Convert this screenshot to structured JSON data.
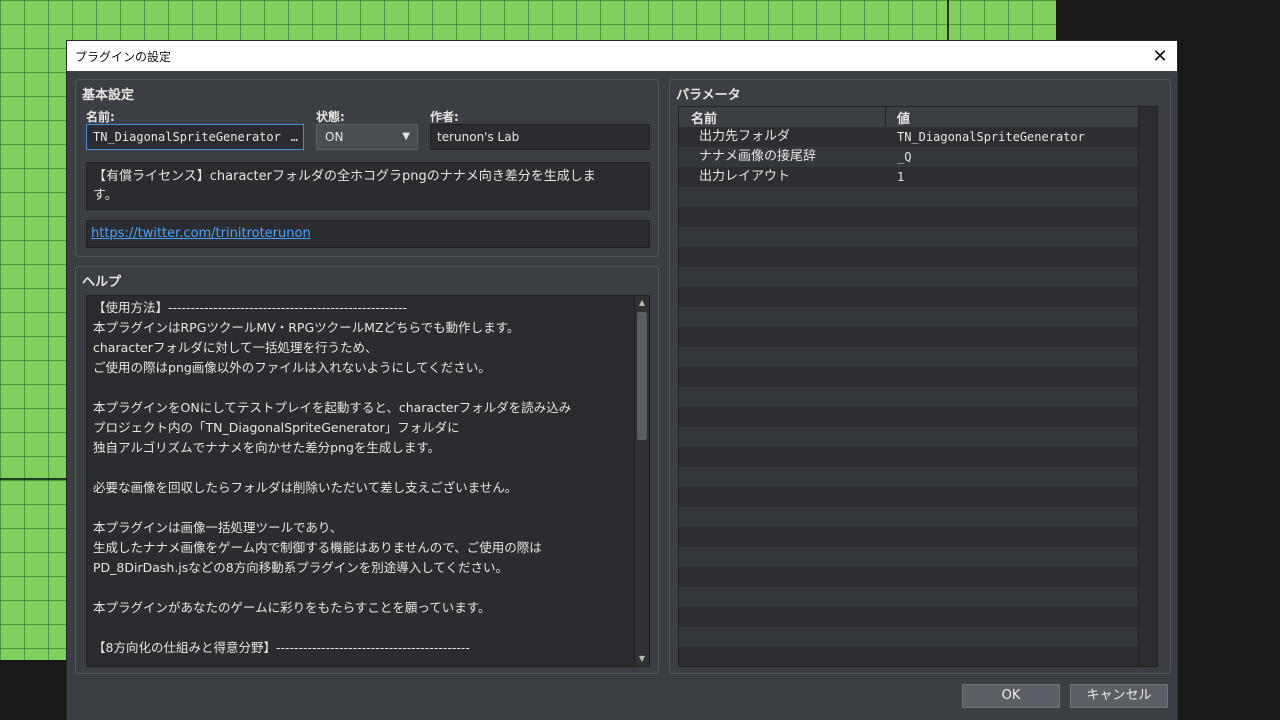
{
  "dialog": {
    "title": "プラグインの設定",
    "close_glyph": "✕"
  },
  "basic": {
    "group_title": "基本設定",
    "name_label": "名前:",
    "name_value": "TN_DiagonalSpriteGenerator",
    "name_button": "…",
    "status_label": "状態:",
    "status_value": "ON",
    "author_label": "作者:",
    "author_value": "terunon's Lab",
    "description_line1": "【有償ライセンス】characterフォルダの全ホコグラpngのナナメ向き差分を生成しま",
    "description_line2": "す。",
    "url": "https://twitter.com/trinitroterunon"
  },
  "help": {
    "group_title": "ヘルプ",
    "lines": [
      "【使用方法】-----------------------------------------------------",
      "本プラグインはRPGツクールMV・RPGツクールMZどちらでも動作します。",
      "characterフォルダに対して一括処理を行うため、",
      "ご使用の際はpng画像以外のファイルは入れないようにしてください。",
      "",
      "本プラグインをONにしてテストプレイを起動すると、characterフォルダを読み込み",
      "プロジェクト内の「TN_DiagonalSpriteGenerator」フォルダに",
      "独自アルゴリズムでナナメを向かせた差分pngを生成します。",
      "",
      "必要な画像を回収したらフォルダは削除いただいて差し支えございません。",
      "",
      "本プラグインは画像一括処理ツールであり、",
      "生成したナナメ画像をゲーム内で制御する機能はありませんので、ご使用の際は",
      "PD_8DirDash.jsなどの8方向移動系プラグインを別途導入してください。",
      "",
      "本プラグインがあなたのゲームに彩りをもたらすことを願っています。",
      "",
      "【8方向化の仕組みと得意分野】-------------------------------------------"
    ]
  },
  "params": {
    "group_title": "パラメータ",
    "col_name": "名前",
    "col_value": "値",
    "rows": [
      {
        "name": "出力先フォルダ",
        "value": "TN_DiagonalSpriteGenerator"
      },
      {
        "name": "ナナメ画像の接尾辞",
        "value": "_Q"
      },
      {
        "name": "出力レイアウト",
        "value": "1"
      }
    ]
  },
  "buttons": {
    "ok": "OK",
    "cancel": "キャンセル"
  }
}
